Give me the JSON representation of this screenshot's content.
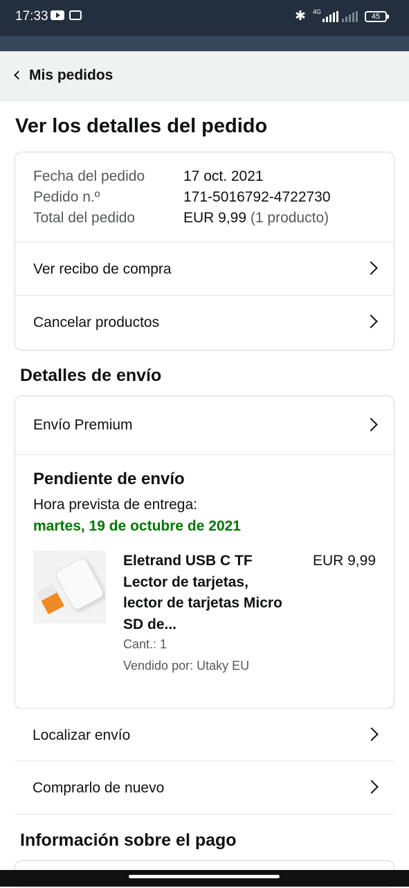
{
  "status_bar": {
    "time": "17:33",
    "network": "4G",
    "battery": "45"
  },
  "nav": {
    "back_label": "Mis pedidos"
  },
  "page_title": "Ver los detalles del pedido",
  "order_summary": {
    "rows": [
      {
        "label": "Fecha del pedido",
        "value": "17 oct. 2021",
        "extra": ""
      },
      {
        "label": "Pedido n.º",
        "value": "171-5016792-4722730",
        "extra": ""
      },
      {
        "label": "Total del pedido",
        "value": "EUR 9,99",
        "extra": "(1 producto)"
      }
    ],
    "actions": [
      "Ver recibo de compra",
      "Cancelar productos"
    ]
  },
  "shipping": {
    "heading": "Detalles de envío",
    "method": "Envío Premium",
    "status": "Pendiente de envío",
    "eta_label": "Hora prevista de entrega:",
    "eta_date": "martes, 19 de octubre de 2021",
    "product": {
      "name": "Eletrand USB C TF Lector de tarjetas, lector de tarjetas Micro SD de...",
      "price": "EUR 9,99",
      "quantity": "Cant.: 1",
      "seller": "Vendido por: Utaky EU"
    },
    "actions": [
      "Localizar envío",
      "Comprarlo de nuevo"
    ]
  },
  "payment": {
    "heading": "Información sobre el pago"
  },
  "colors": {
    "status_bar_bg": "#232f3e",
    "eta_green": "#007600"
  }
}
